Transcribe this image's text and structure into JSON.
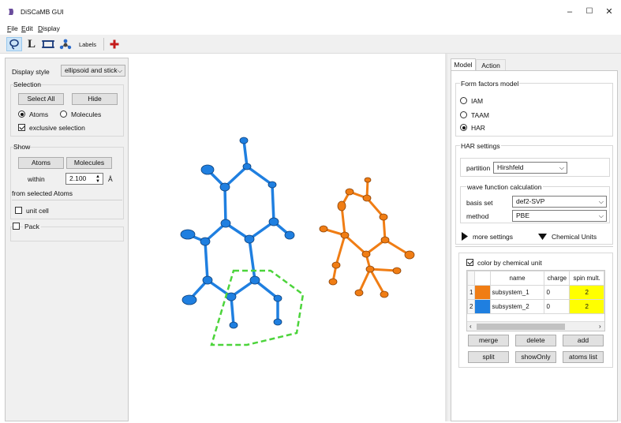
{
  "window": {
    "title": "DiSCaMB GUI",
    "minimize": "–",
    "maximize": "☐",
    "close": "✕"
  },
  "menu": [
    {
      "key": "F",
      "rest": "ile"
    },
    {
      "key": "E",
      "rest": "dit"
    },
    {
      "key": "D",
      "rest": "isplay"
    }
  ],
  "toolbar": {
    "labels_text": "Labels"
  },
  "left": {
    "display_style_label": "Display style",
    "display_style_value": "ellipsoid and stick",
    "selection_title": "Selection",
    "select_all": "Select All",
    "hide": "Hide",
    "atoms_radio": "Atoms",
    "molecules_radio": "Molecules",
    "atoms_selected": true,
    "exclusive_selection": "exclusive selection",
    "exclusive_checked": true,
    "show_title": "Show",
    "show_atoms": "Atoms",
    "show_molecules": "Molecules",
    "within": "within",
    "within_value": "2.100",
    "unit": "Å",
    "from_selected": "from selected Atoms",
    "unit_cell": "unit cell",
    "pack": "Pack"
  },
  "right": {
    "tabs": [
      {
        "label": "Model",
        "active": true
      },
      {
        "label": "Action",
        "active": false
      }
    ],
    "form_factors_title": "Form factors model",
    "ff_options": [
      {
        "label": "IAM",
        "checked": false
      },
      {
        "label": "TAAM",
        "checked": false
      },
      {
        "label": "HAR",
        "checked": true
      }
    ],
    "har_settings_title": "HAR settings",
    "partition_label": "partition",
    "partition_value": "Hirshfeld",
    "wfc_title": "wave function calculation",
    "basis_set_label": "basis set",
    "basis_set_value": "def2-SVP",
    "method_label": "method",
    "method_value": "PBE",
    "more_settings": "more settings",
    "chemical_units": "Chemical Units",
    "color_by_unit": "color by chemical unit",
    "color_by_checked": true,
    "table": {
      "headers": [
        "name",
        "charge",
        "spin mult."
      ],
      "rows": [
        {
          "index": "1",
          "color": "#f07d14",
          "name": "subsystem_1",
          "charge": "0",
          "spin": "2"
        },
        {
          "index": "2",
          "color": "#1f7fe0",
          "name": "subsystem_2",
          "charge": "0",
          "spin": "2"
        }
      ]
    },
    "merge": "merge",
    "delete": "delete",
    "add": "add",
    "split": "split",
    "showOnly": "showOnly",
    "atoms_list": "atoms list"
  },
  "colors": {
    "blue_molecule": "#1f7fe0",
    "orange_molecule": "#f07d14",
    "selection_outline": "#4cd43b",
    "spin_highlight": "#ffff00"
  }
}
